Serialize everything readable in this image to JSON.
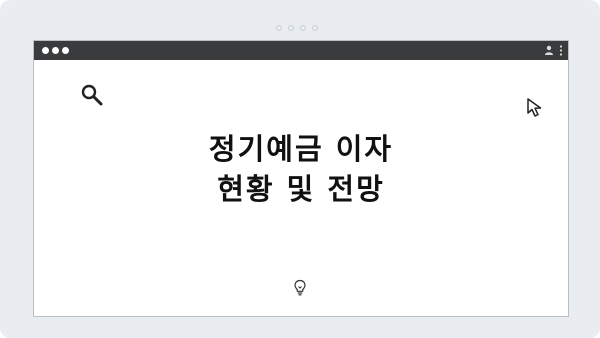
{
  "window": {
    "title_lines": "정기예금 이자\n현황 및 전망"
  },
  "icons": {
    "search": "search-icon",
    "cursor": "cursor-arrow-icon",
    "user": "user-icon",
    "menu": "kebab-menu-icon",
    "bulb": "lightbulb-icon"
  },
  "colors": {
    "titlebar": "#3a3b3d",
    "background": "#e9edf1",
    "text": "#111111"
  }
}
